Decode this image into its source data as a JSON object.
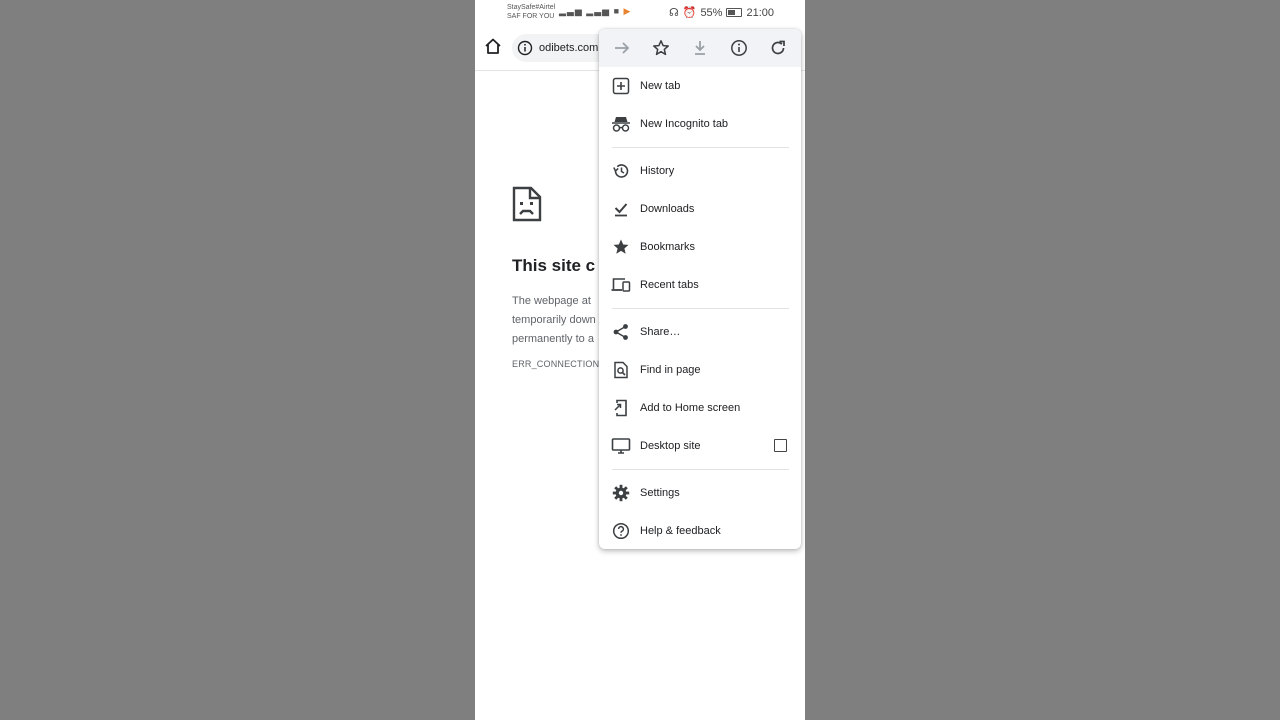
{
  "status_bar": {
    "carrier_line1": "StaySafe#Airtel",
    "carrier_line2": "SAF FOR YOU",
    "battery": "55%",
    "time": "21:00"
  },
  "toolbar": {
    "url": "odibets.com"
  },
  "error_page": {
    "title": "This site c",
    "desc_line1": "The webpage at",
    "desc_line2": "temporarily down",
    "desc_line3": "permanently to a",
    "code": "ERR_CONNECTION_A"
  },
  "menu": {
    "top_icons": [
      "forward-icon",
      "star-outline-icon",
      "download-icon",
      "info-icon",
      "refresh-icon"
    ],
    "items": [
      {
        "label": "New tab",
        "icon": "plus-box-icon"
      },
      {
        "label": "New Incognito tab",
        "icon": "incognito-icon"
      },
      {
        "label": "History",
        "icon": "history-icon"
      },
      {
        "label": "Downloads",
        "icon": "download-done-icon"
      },
      {
        "label": "Bookmarks",
        "icon": "star-filled-icon"
      },
      {
        "label": "Recent tabs",
        "icon": "devices-icon"
      },
      {
        "label": "Share…",
        "icon": "share-icon"
      },
      {
        "label": "Find in page",
        "icon": "find-in-page-icon"
      },
      {
        "label": "Add to Home screen",
        "icon": "add-to-home-icon"
      },
      {
        "label": "Desktop site",
        "icon": "desktop-icon",
        "checked": false
      },
      {
        "label": "Settings",
        "icon": "gear-icon"
      },
      {
        "label": "Help & feedback",
        "icon": "help-icon"
      }
    ]
  },
  "colors": {
    "accent": "#202124",
    "icon": "#3c4043",
    "menu_top_bg": "#f1f3f6",
    "side_bg": "#7f7f7f"
  }
}
